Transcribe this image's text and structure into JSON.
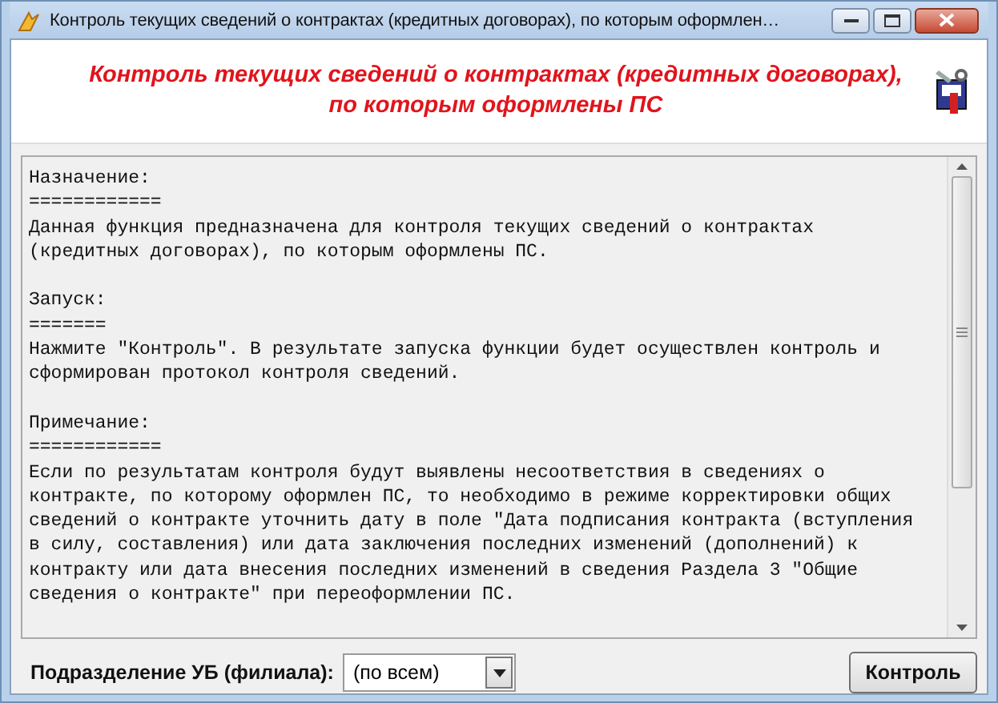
{
  "window": {
    "title": "Контроль текущих сведений о контрактах (кредитных договорах), по которым оформлен…"
  },
  "header": {
    "heading": "Контроль текущих сведений о контрактах (кредитных договорах),\nпо которым оформлены ПС"
  },
  "memo": {
    "sections": [
      {
        "heading": "Назначение:",
        "rule": "============",
        "body": "Данная функция предназначена для контроля текущих сведений о контрактах\n(кредитных договорах), по которым оформлены ПС."
      },
      {
        "heading": "Запуск:",
        "rule": "=======",
        "body": "Нажмите \"Контроль\". В результате запуска функции будет осуществлен контроль и\nсформирован протокол контроля сведений."
      },
      {
        "heading": "Примечание:",
        "rule": "============",
        "body": "Если по результатам контроля будут выявлены несоответствия в сведениях о\nконтракте, по которому оформлен ПС, то необходимо в режиме корректировки общих\nсведений о контракте уточнить дату в поле \"Дата подписания контракта (вступления\nв силу, составления) или дата заключения последних изменений (дополнений) к\nконтракту или дата внесения последних изменений в сведения Раздела 3 \"Общие\nсведения о контракте\" при переоформлении ПС."
      }
    ]
  },
  "footer": {
    "filter_label": "Подразделение УБ (филиала):",
    "filter_value": "(по всем)",
    "button": "Контроль"
  }
}
